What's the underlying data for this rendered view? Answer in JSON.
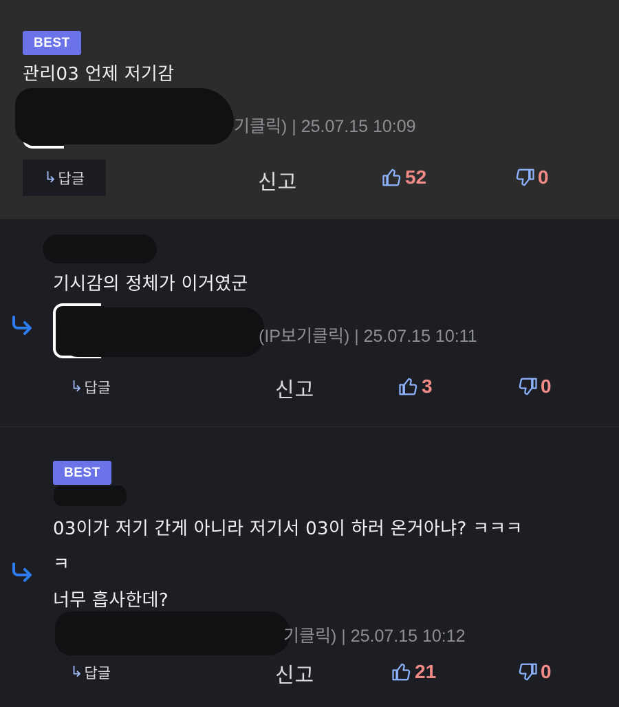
{
  "comments": [
    {
      "badge": "BEST",
      "text_lines": [
        "관리03 언제 저기감"
      ],
      "meta": "기클릭) | 25.07.15 10:09",
      "reply_label": "답글",
      "report_label": "신고",
      "likes": "52",
      "dislikes": "0"
    },
    {
      "text_lines": [
        "기시감의 정체가 이거였군"
      ],
      "meta": "(IP보기클릭) | 25.07.15 10:11",
      "reply_label": "답글",
      "report_label": "신고",
      "likes": "3",
      "dislikes": "0"
    },
    {
      "badge": "BEST",
      "text_lines": [
        "03이가 저기 간게 아니라 저기서 03이 하러 온거아냐? ㅋㅋㅋ",
        "ㅋ",
        "너무 흡사한데?"
      ],
      "meta": "기클릭) | 25.07.15 10:12",
      "reply_label": "답글",
      "report_label": "신고",
      "likes": "21",
      "dislikes": "0"
    }
  ],
  "icons": {
    "reply": "reply-arrow-icon",
    "thread": "nested-reply-arrow-icon",
    "like": "thumbs-up-icon",
    "dislike": "thumbs-down-icon"
  },
  "colors": {
    "badge": "#6b73e8",
    "vote_count": "#f28a86",
    "thumb_icon": "#8fb4ff",
    "thread_arrow": "#2f7bf0"
  }
}
